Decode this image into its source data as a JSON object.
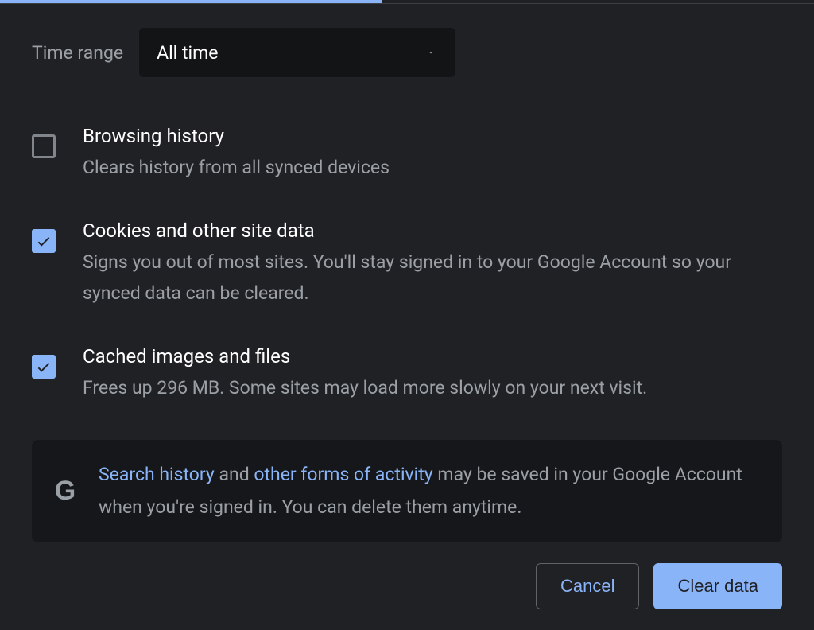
{
  "timeRange": {
    "label": "Time range",
    "selected": "All time"
  },
  "options": {
    "browsingHistory": {
      "title": "Browsing history",
      "desc": "Clears history from all synced devices",
      "checked": false
    },
    "cookies": {
      "title": "Cookies and other site data",
      "desc": "Signs you out of most sites. You'll stay signed in to your Google Account so your synced data can be cleared.",
      "checked": true
    },
    "cache": {
      "title": "Cached images and files",
      "desc": "Frees up 296 MB. Some sites may load more slowly on your next visit.",
      "checked": true
    }
  },
  "info": {
    "link1": "Search history",
    "mid1": " and ",
    "link2": "other forms of activity",
    "tail": " may be saved in your Google Account when you're signed in. You can delete them anytime."
  },
  "buttons": {
    "cancel": "Cancel",
    "clear": "Clear data"
  },
  "colors": {
    "accent": "#8ab4f8",
    "bg": "#202124",
    "muted": "#9aa0a6"
  }
}
